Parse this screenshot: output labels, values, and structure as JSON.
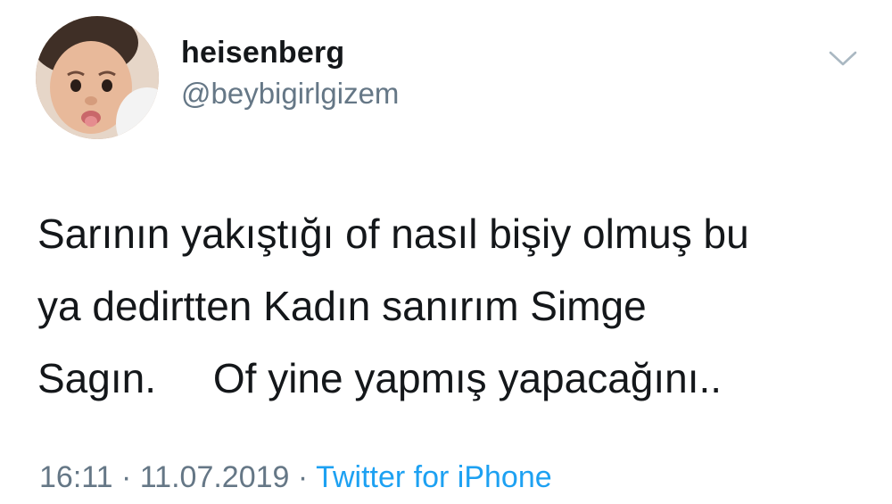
{
  "tweet": {
    "author": {
      "display_name": "heisenberg",
      "handle": "@beybigirlgizem"
    },
    "text_lines": [
      "Sarının yakıştığı of nasıl bişiy olmuş bu",
      "ya dedirtten Kadın sanırım Simge",
      "Sagın.     Of yine yapmış yapacağını.."
    ],
    "time": "16:11",
    "separator": "·",
    "date": "11.07.2019",
    "source": "Twitter for iPhone"
  },
  "colors": {
    "text": "#14171a",
    "secondary": "#657786",
    "link": "#1da1f2",
    "background": "#ffffff"
  },
  "icons": {
    "caret": "chevron-down-icon",
    "avatar": "profile-photo"
  }
}
